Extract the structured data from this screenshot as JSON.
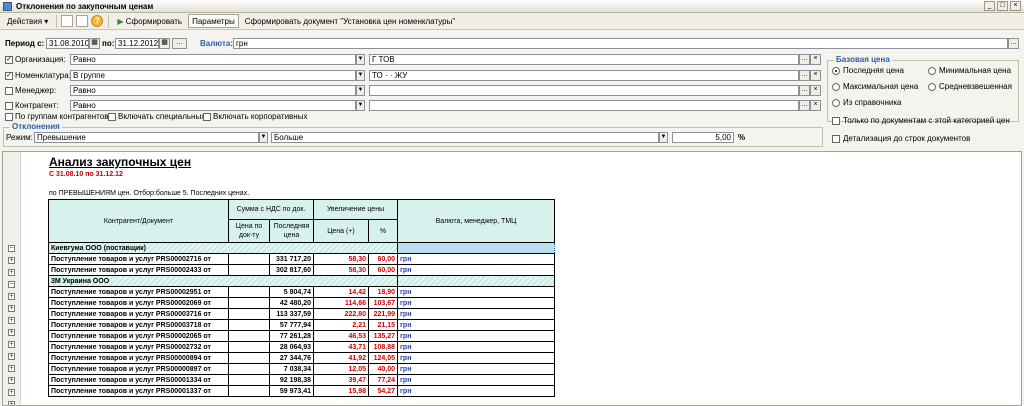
{
  "window": {
    "title": "Отклонения по закупочным ценам"
  },
  "toolbar": {
    "actions": "Действия",
    "generate": "Сформировать",
    "params": "Параметры",
    "generate_doc": "Сформировать документ \"Установка цен номенклатуры\""
  },
  "filters": {
    "period_label": "Период с:",
    "period_from": "31.08.2010",
    "period_to_label": "по:",
    "period_to": "31.12.2012",
    "currency_label": "Валюта:",
    "currency": "грн",
    "rows": [
      {
        "label": "Организация:",
        "checked": true,
        "mode": "Равно",
        "value": "Г          ТОВ"
      },
      {
        "label": "Номенклатура:",
        "checked": true,
        "mode": "В группе",
        "value": "ТО            ·       ·      ЖУ"
      },
      {
        "label": "Менеджер:",
        "checked": false,
        "mode": "Равно",
        "value": ""
      },
      {
        "label": "Контрагент:",
        "checked": false,
        "mode": "Равно",
        "value": ""
      }
    ],
    "by_groups": "По группам контрагентов",
    "include_special": "Включать специальных",
    "include_corporate": "Включать корпоративных"
  },
  "deviations": {
    "title": "Отклонения",
    "mode_label": "Режим:",
    "mode": "Превышение",
    "compare": "Больше",
    "value": "5,00",
    "unit": "%"
  },
  "base_price": {
    "title": "Базовая цена",
    "options": [
      "Последняя цена",
      "Минимальная цена",
      "Максимальная цена",
      "Средневзвешенная",
      "Из справочника"
    ],
    "only_docs": "Только по документам с этой категорией цен",
    "detail": "Детализация до строк документов"
  },
  "report": {
    "title": "Анализ закупочных цен",
    "period": "С 31.08.10 по 31.12.12",
    "filter": "по ПРЕВЫШЕНИЯМ цен. Отбор:больше 5. Последних ценах.",
    "headers": {
      "counterparty": "Контрагент/Документ",
      "sum_vat": "Сумма с НДС по док.",
      "price_doc": "Цена по док-ту",
      "last_price": "Последняя цена",
      "increase": "Увеличение цены",
      "price_plus": "Цена (+)",
      "percent": "%",
      "currency_mgr": "Валюта, менеджер, ТМЦ"
    },
    "groups": [
      {
        "name": "Киевгума ООО (поставщик)",
        "rows": [
          {
            "doc": "Поступление товаров и услуг PRS00002716 от",
            "last": "331 717,20",
            "plus": "58,30",
            "pct": "60,00",
            "cur": "грн"
          },
          {
            "doc": "Поступление товаров и услуг PRS00002433 от",
            "last": "302 817,60",
            "plus": "58,30",
            "pct": "60,00",
            "cur": "грн"
          }
        ]
      },
      {
        "name": "3М Украина ООО",
        "rows": [
          {
            "doc": "Поступление товаров и услуг PRS00002951 от",
            "last": "5 804,74",
            "plus": "14,42",
            "pct": "18,90",
            "cur": "грн"
          },
          {
            "doc": "Поступление товаров и услуг PRS00002069 от",
            "last": "42 480,20",
            "plus": "114,66",
            "pct": "103,67",
            "cur": "грн"
          },
          {
            "doc": "Поступление товаров и услуг PRS00003716 от",
            "last": "113 337,59",
            "plus": "222,80",
            "pct": "221,99",
            "cur": "грн"
          },
          {
            "doc": "Поступление товаров и услуг PRS00003718 от",
            "last": "57 777,94",
            "plus": "2,21",
            "pct": "21,15",
            "cur": "грн"
          },
          {
            "doc": "Поступление товаров и услуг PRS00002065 от",
            "last": "77 261,28",
            "plus": "46,53",
            "pct": "135,27",
            "cur": "грн"
          },
          {
            "doc": "Поступление товаров и услуг PRS00002732 от",
            "last": "28 064,93",
            "plus": "43,71",
            "pct": "108,88",
            "cur": "грн"
          },
          {
            "doc": "Поступление товаров и услуг PRS00000894 от",
            "last": "27 344,76",
            "plus": "41,92",
            "pct": "124,05",
            "cur": "грн"
          },
          {
            "doc": "Поступление товаров и услуг PRS00000897 от",
            "last": "7 038,34",
            "plus": "12,05",
            "pct": "40,00",
            "cur": "грн"
          },
          {
            "doc": "Поступление товаров и услуг PRS00001334 от",
            "last": "92 198,38",
            "plus": "39,47",
            "pct": "77,24",
            "cur": "грн"
          },
          {
            "doc": "Поступление товаров и услуг PRS00001337 от",
            "last": "59 973,41",
            "plus": "15,98",
            "pct": "54,27",
            "cur": "грн"
          }
        ]
      }
    ]
  }
}
